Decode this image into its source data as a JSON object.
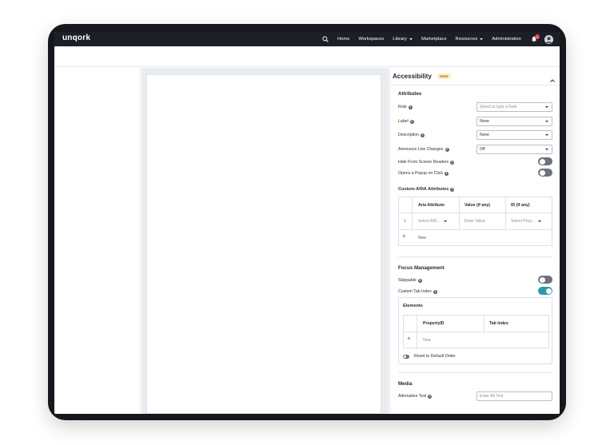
{
  "app": {
    "logo": "unqork",
    "nav": {
      "home": "Home",
      "workspaces": "Workspaces",
      "library": "Library",
      "marketplace": "Marketplace",
      "resources": "Resources",
      "administration": "Administration",
      "notification_count": "1"
    }
  },
  "panel": {
    "title": "Accessibility",
    "badge": "NEW",
    "attributes": {
      "title": "Attributes",
      "role": {
        "label": "Role",
        "placeholder": "Select or type a Role"
      },
      "label": {
        "label": "Label",
        "value": "None"
      },
      "description": {
        "label": "Description",
        "value": "None"
      },
      "announce": {
        "label": "Announce Live Changes",
        "value": "Off"
      },
      "hide_readers": {
        "label": "Hide From Screen Readers",
        "on": false
      },
      "popup": {
        "label": "Opens a Popup on Click",
        "on": false
      }
    },
    "custom_aria": {
      "title": "Custom ARIA Attributes",
      "headers": {
        "attribute": "Aria Attribute",
        "value": "Value (if any)",
        "id": "ID (if any)"
      },
      "row": {
        "index": "1",
        "attribute": "Select ARI...",
        "value": "Enter Value",
        "id": "Select Prop..."
      },
      "add_label": "New"
    },
    "focus": {
      "title": "Focus Management",
      "skippable": {
        "label": "Skippable",
        "on": false
      },
      "custom_tab": {
        "label": "Custom Tab Index",
        "on": true
      },
      "elements": {
        "title": "Elements",
        "headers": {
          "property": "PropertyID",
          "tab_index": "Tab Index"
        },
        "add_label": "New",
        "reset_label": "Reset to Default Order"
      }
    },
    "media": {
      "title": "Media",
      "alt_text": {
        "label": "Alternative Text",
        "placeholder": "Enter Alt Text"
      }
    }
  },
  "colors": {
    "accent": "#2a9aa8",
    "topbar": "#1c1f26",
    "badge_bg": "#fdeccf",
    "badge_text": "#b86e0a"
  }
}
